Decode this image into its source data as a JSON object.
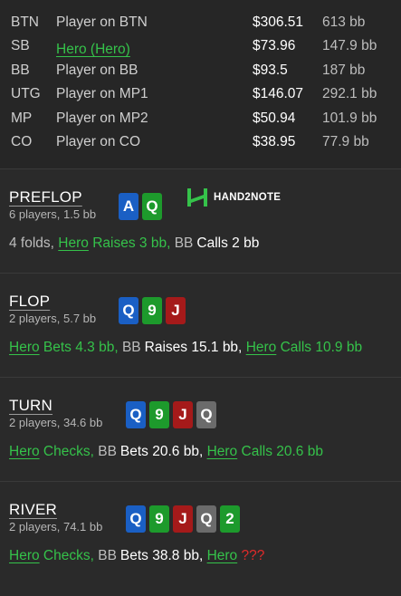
{
  "players": [
    {
      "pos": "BTN",
      "name": "Player on BTN",
      "stack": "$306.51",
      "bb": "613 bb",
      "hero": false
    },
    {
      "pos": "SB",
      "name": "Hero (Hero)",
      "stack": "$73.96",
      "bb": "147.9 bb",
      "hero": true
    },
    {
      "pos": "BB",
      "name": "Player on BB",
      "stack": "$93.5",
      "bb": "187 bb",
      "hero": false
    },
    {
      "pos": "UTG",
      "name": "Player on MP1",
      "stack": "$146.07",
      "bb": "292.1 bb",
      "hero": false
    },
    {
      "pos": "MP",
      "name": "Player on MP2",
      "stack": "$50.94",
      "bb": "101.9 bb",
      "hero": false
    },
    {
      "pos": "CO",
      "name": "Player on CO",
      "stack": "$38.95",
      "bb": "77.9 bb",
      "hero": false
    }
  ],
  "logo": {
    "text": "HAND2NOTE"
  },
  "streets": {
    "preflop": {
      "title": "PREFLOP",
      "subtitle": "6 players, 1.5 bb",
      "cards": [
        {
          "rank": "A",
          "color": "blue"
        },
        {
          "rank": "Q",
          "color": "green"
        }
      ],
      "actions": {
        "folds": "4 folds,",
        "hero": "Hero",
        "hero_action": "Raises 3 bb,",
        "bb": "BB",
        "bb_action": "Calls 2 bb"
      }
    },
    "flop": {
      "title": "FLOP",
      "subtitle": "2 players, 5.7 bb",
      "cards": [
        {
          "rank": "Q",
          "color": "blue"
        },
        {
          "rank": "9",
          "color": "green"
        },
        {
          "rank": "J",
          "color": "red"
        }
      ],
      "actions": {
        "hero": "Hero",
        "hero_action": "Bets 4.3 bb,",
        "bb": "BB",
        "bb_action": "Raises 15.1 bb,",
        "hero2": "Hero",
        "hero2_action": "Calls 10.9 bb"
      }
    },
    "turn": {
      "title": "TURN",
      "subtitle": "2 players, 34.6 bb",
      "cards": [
        {
          "rank": "Q",
          "color": "blue"
        },
        {
          "rank": "9",
          "color": "green"
        },
        {
          "rank": "J",
          "color": "red"
        },
        {
          "rank": "Q",
          "color": "grey"
        }
      ],
      "actions": {
        "hero": "Hero",
        "hero_action": "Checks,",
        "bb": "BB",
        "bb_action": "Bets 20.6 bb,",
        "hero2": "Hero",
        "hero2_action": "Calls 20.6 bb"
      }
    },
    "river": {
      "title": "RIVER",
      "subtitle": "2 players, 74.1 bb",
      "cards": [
        {
          "rank": "Q",
          "color": "blue"
        },
        {
          "rank": "9",
          "color": "green"
        },
        {
          "rank": "J",
          "color": "red"
        },
        {
          "rank": "Q",
          "color": "grey"
        },
        {
          "rank": "2",
          "color": "green"
        }
      ],
      "actions": {
        "hero": "Hero",
        "hero_action": "Checks,",
        "bb": "BB",
        "bb_action": "Bets 38.8 bb,",
        "hero2": "Hero",
        "hero2_action": "???"
      }
    }
  },
  "colors": {
    "hero": "#35c24a",
    "unknown": "#e02a2a",
    "card_blue": "#1a5fc4",
    "card_green": "#1d9a2c",
    "card_red": "#a51a1a",
    "card_grey": "#6b6b6b"
  }
}
